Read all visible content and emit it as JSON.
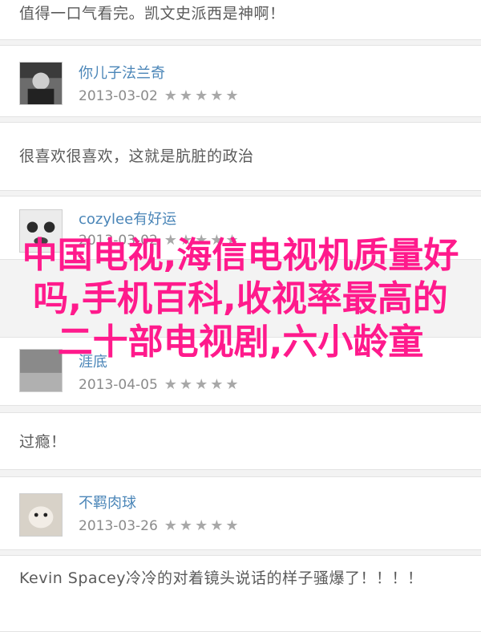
{
  "reviews": [
    {
      "comment": "值得一口气看完。凯文史派西是神啊！"
    },
    {
      "username": "你儿子法兰奇",
      "date": "2013-03-02",
      "stars": "★★★★★",
      "comment": "很喜欢很喜欢，这就是肮脏的政治"
    },
    {
      "username": "cozylee有好运",
      "date": "2013-03-02",
      "stars": "★★★★★"
    },
    {
      "username": "涯底",
      "date": "2013-04-05",
      "stars": "★★★★★",
      "comment": "过瘾！"
    },
    {
      "username": "不羁肉球",
      "date": "2013-03-26",
      "stars": "★★★★★",
      "comment": "Kevin Spacey冷冷的对着镜头说话的样子骚爆了！！！！"
    }
  ],
  "overlay_title": "中国电视,海信电视机质量好吗,手机百科,收视率最高的二十部电视剧,六小龄童"
}
